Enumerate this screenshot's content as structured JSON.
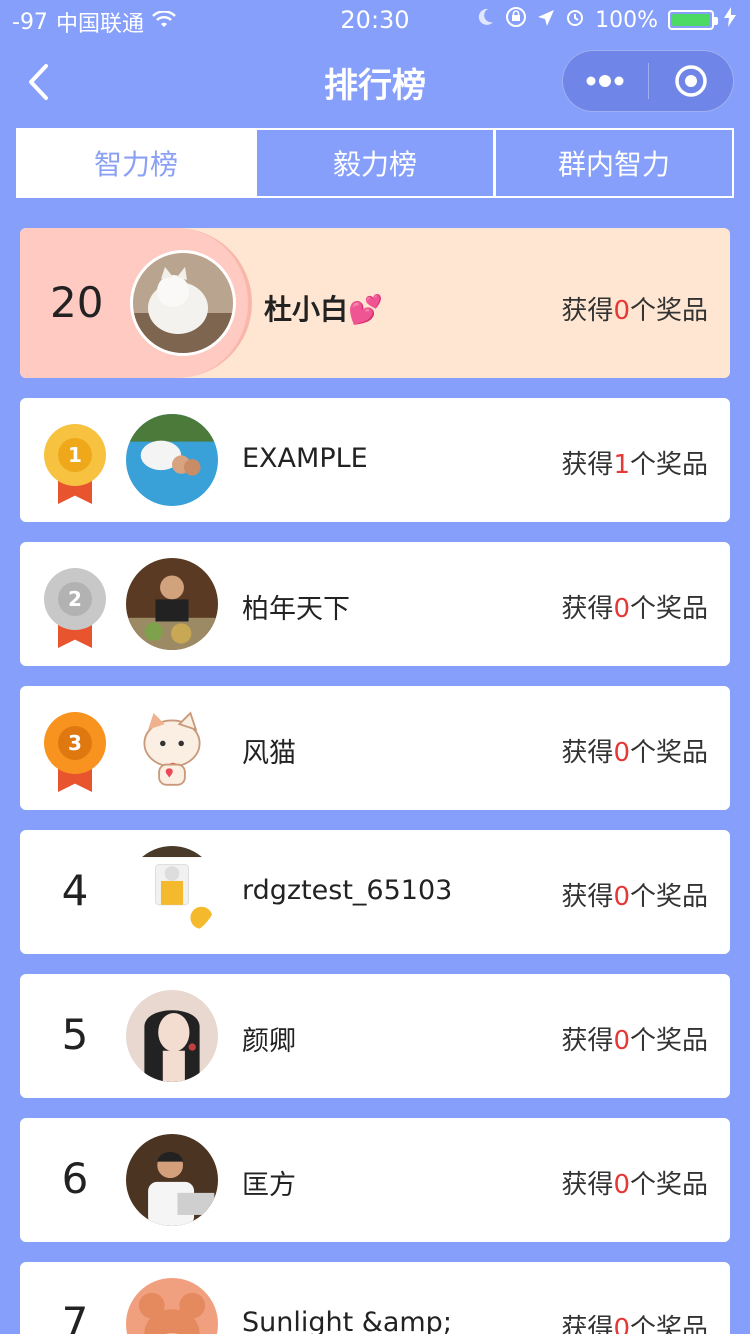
{
  "status": {
    "signal": "-97",
    "carrier": "中国联通",
    "time": "20:30",
    "battery": "100%"
  },
  "nav": {
    "title": "排行榜"
  },
  "tabs": [
    {
      "label": "智力榜",
      "active": true
    },
    {
      "label": "毅力榜",
      "active": false
    },
    {
      "label": "群内智力",
      "active": false
    }
  ],
  "me": {
    "rank": "20",
    "name": "杜小白💕",
    "award_prefix": "获得",
    "award_count": "0",
    "award_suffix": "个奖品"
  },
  "list": [
    {
      "rank": "1",
      "name": "EXAMPLE",
      "award_prefix": "获得",
      "award_count": "1",
      "award_suffix": "个奖品",
      "medal_color": "#f6c240"
    },
    {
      "rank": "2",
      "name": "柏年天下",
      "award_prefix": "获得",
      "award_count": "0",
      "award_suffix": "个奖品",
      "medal_color": "#c8c8c8"
    },
    {
      "rank": "3",
      "name": "风猫",
      "award_prefix": "获得",
      "award_count": "0",
      "award_suffix": "个奖品",
      "medal_color": "#f7931e"
    },
    {
      "rank": "4",
      "name": "rdgztest_65103",
      "award_prefix": "获得",
      "award_count": "0",
      "award_suffix": "个奖品"
    },
    {
      "rank": "5",
      "name": "颜卿",
      "award_prefix": "获得",
      "award_count": "0",
      "award_suffix": "个奖品"
    },
    {
      "rank": "6",
      "name": "匡方",
      "award_prefix": "获得",
      "award_count": "0",
      "award_suffix": "个奖品"
    },
    {
      "rank": "7",
      "name": "Sunlight &amp;",
      "award_prefix": "获得",
      "award_count": "0",
      "award_suffix": "个奖品"
    }
  ],
  "colors": {
    "background": "#869ffb",
    "award_count": "#e53935",
    "my_card": "#ffe6d2"
  }
}
